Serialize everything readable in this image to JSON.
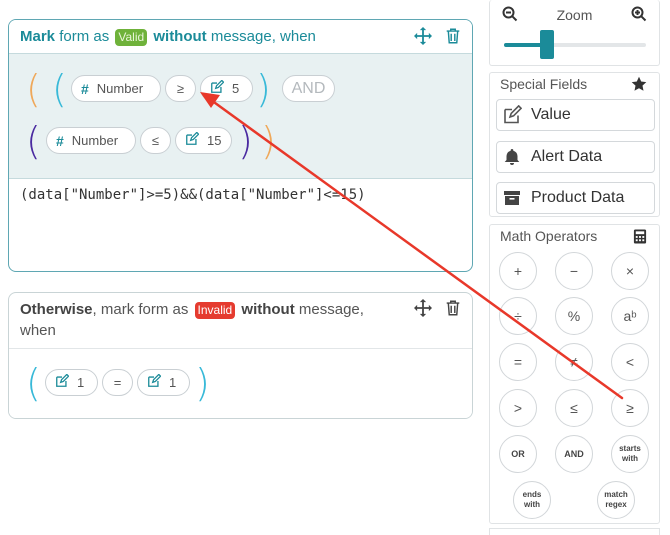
{
  "valid_rule": {
    "head": {
      "mark": "Mark",
      "form_as": " form as ",
      "badge": "Valid",
      "without": " without",
      "message_when": " message, when"
    },
    "expression": {
      "field_1": "Number",
      "op_1": "≥",
      "value_1": "5",
      "joiner": "AND",
      "field_2": "Number",
      "op_2": "≤",
      "value_2": "15"
    },
    "code": "(data[\"Number\"]>=5)&&(data[\"Number\"]<=15)"
  },
  "otherwise_rule": {
    "head": {
      "otherwise": "Otherwise",
      "mark_form_as": ", mark form as ",
      "badge": "Invalid",
      "without": " without",
      "message": " message,",
      "when": "when"
    },
    "expression": {
      "value_left": "1",
      "op": "=",
      "value_right": "1"
    }
  },
  "zoom": {
    "label": "Zoom",
    "level": 0.3
  },
  "special_fields": {
    "title": "Special Fields",
    "items": [
      {
        "label": "Value",
        "icon": "edit-icon"
      },
      {
        "label": "Alert Data",
        "icon": "bell-icon"
      },
      {
        "label": "Product Data",
        "icon": "archive-icon"
      }
    ]
  },
  "math_operators": {
    "title": "Math Operators",
    "rows": [
      [
        "+",
        "−",
        "×"
      ],
      [
        "÷",
        "%",
        "aᵇ"
      ],
      [
        "=",
        "≠",
        "<"
      ],
      [
        ">",
        "≤",
        "≥"
      ],
      [
        "OR",
        "AND",
        "starts with"
      ],
      [
        "ends with",
        "match regex"
      ]
    ]
  },
  "colors": {
    "accent": "#1b8b99",
    "valid": "#6fb23a",
    "invalid": "#e53b2f",
    "arrow": "#e8382a"
  }
}
